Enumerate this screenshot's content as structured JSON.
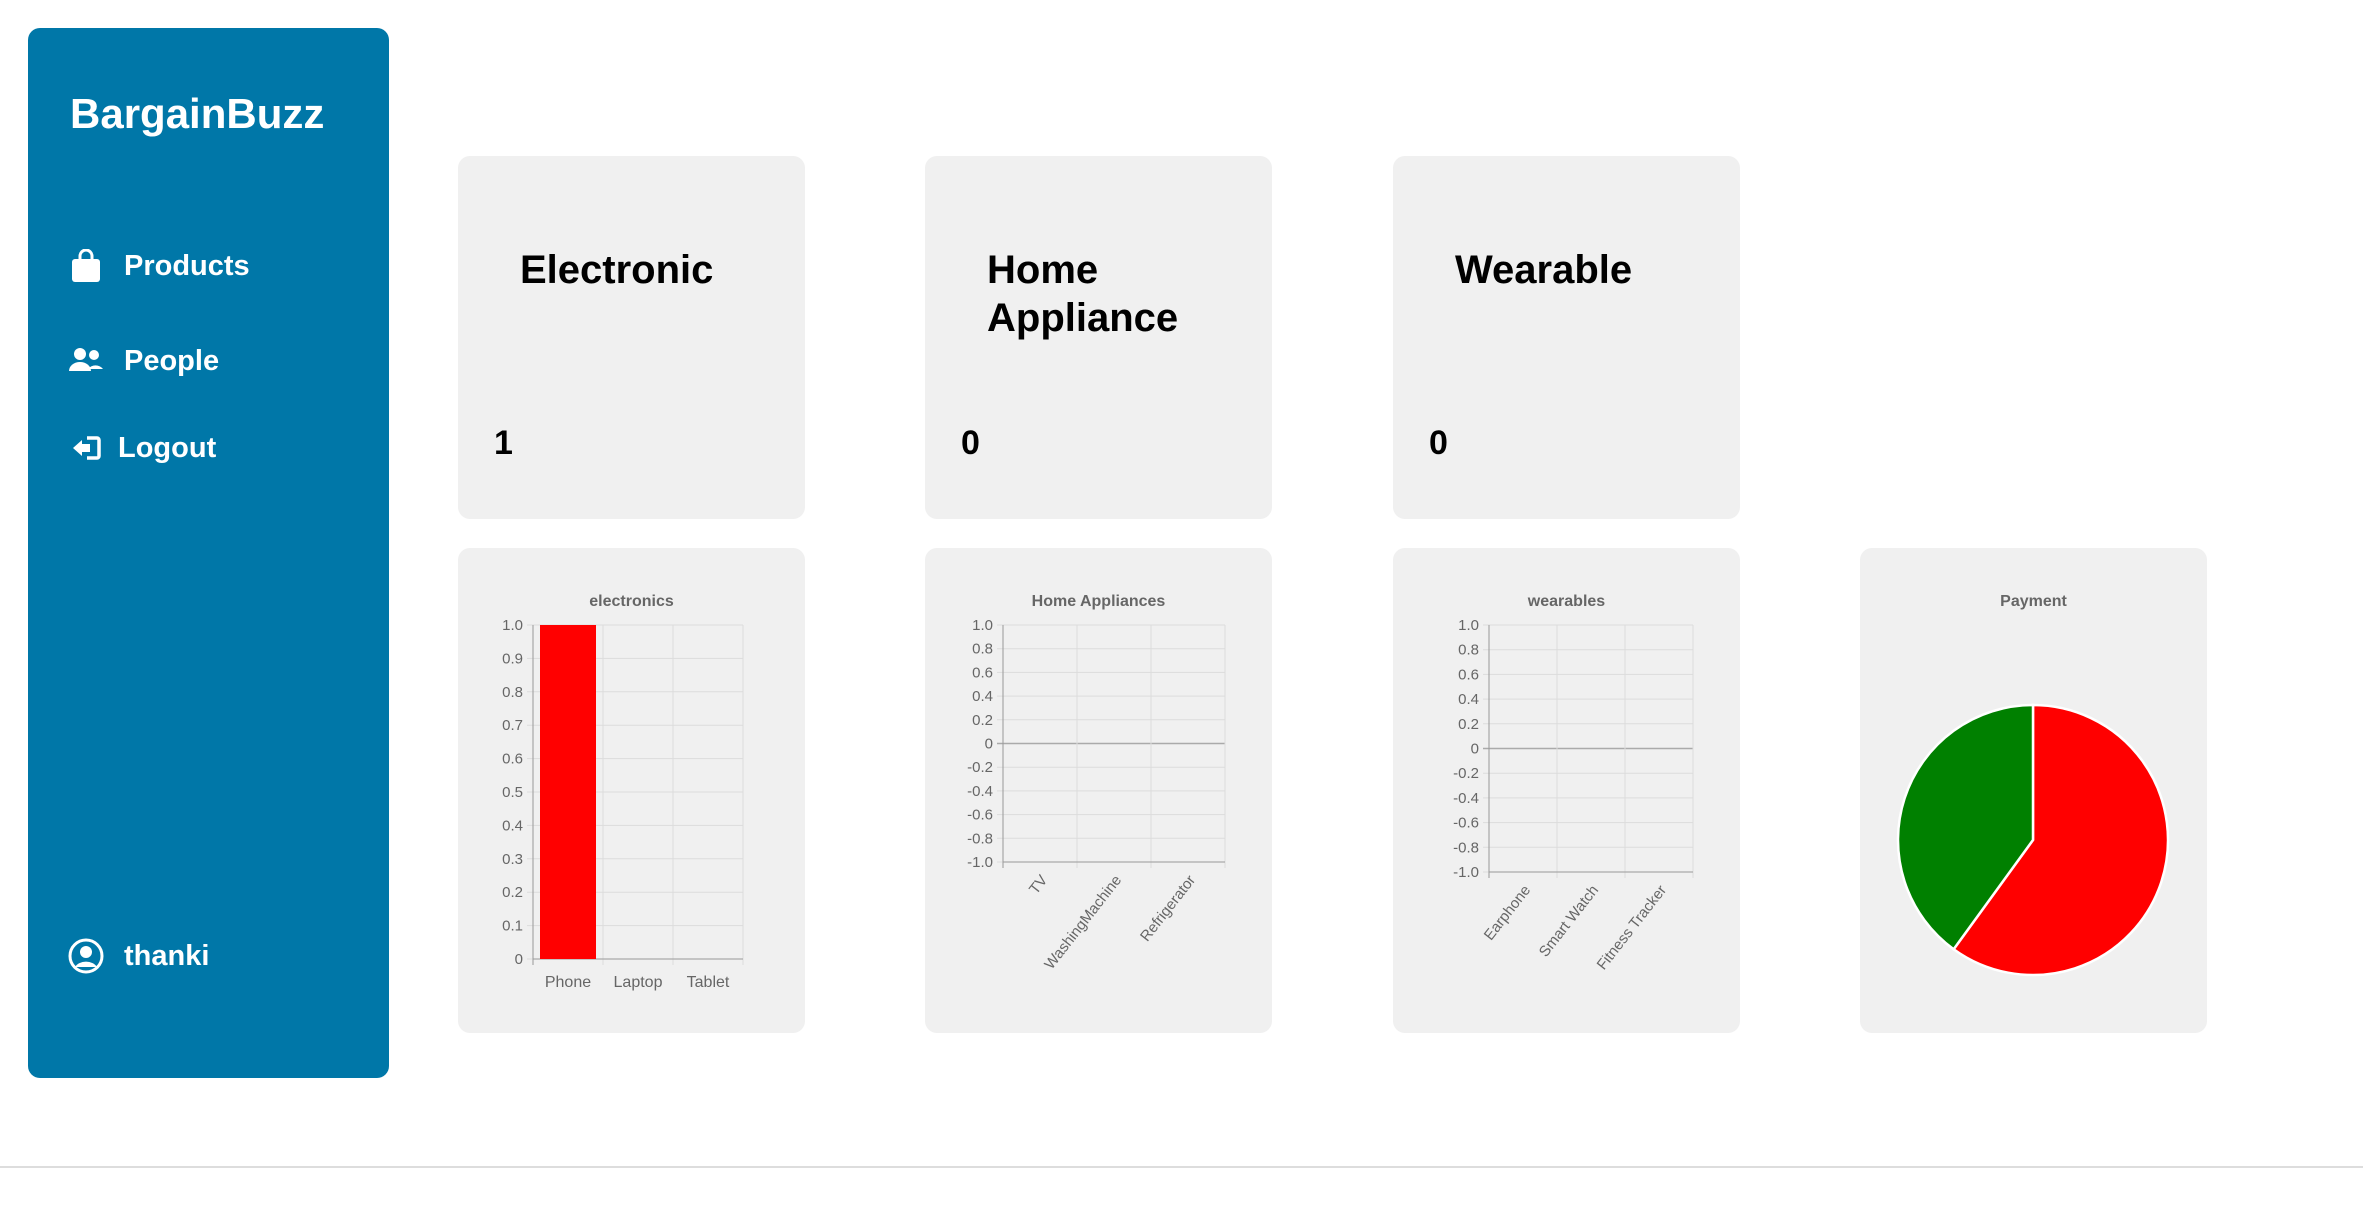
{
  "app": {
    "brand": "BargainBuzz"
  },
  "sidebar": {
    "items": [
      {
        "label": "Products",
        "icon": "shopping-bag-icon"
      },
      {
        "label": "People",
        "icon": "users-icon"
      },
      {
        "label": "Logout",
        "icon": "logout-icon"
      }
    ],
    "user": {
      "name": "thanki",
      "icon": "user-circle-icon"
    }
  },
  "stats": [
    {
      "title": "Electronic",
      "count": "1"
    },
    {
      "title": "Home Appliance",
      "count": "0"
    },
    {
      "title": "Wearable",
      "count": "0"
    }
  ],
  "colors": {
    "sidebar": "#0077a8",
    "card": "#f0f0f0",
    "bar": "#ff0000",
    "pie_red": "#ff0000",
    "pie_green": "#008000"
  },
  "chart_data": [
    {
      "type": "bar",
      "title": "electronics",
      "categories": [
        "Phone",
        "Laptop",
        "Tablet"
      ],
      "values": [
        1,
        0,
        0
      ],
      "ylim": [
        0,
        1.0
      ],
      "yticks": [
        "0",
        "0.1",
        "0.2",
        "0.3",
        "0.4",
        "0.5",
        "0.6",
        "0.7",
        "0.8",
        "0.9",
        "1.0"
      ],
      "grid": true
    },
    {
      "type": "bar",
      "title": "Home Appliances",
      "categories": [
        "TV",
        "WashingMachine",
        "Refrigerator"
      ],
      "values": [
        0,
        0,
        0
      ],
      "ylim": [
        -1.0,
        1.0
      ],
      "yticks": [
        "-1.0",
        "-0.8",
        "-0.6",
        "-0.4",
        "-0.2",
        "0",
        "0.2",
        "0.4",
        "0.6",
        "0.8",
        "1.0"
      ],
      "grid": true
    },
    {
      "type": "bar",
      "title": "wearables",
      "categories": [
        "Earphone",
        "Smart Watch",
        "Fitness Tracker"
      ],
      "values": [
        0,
        0,
        0
      ],
      "ylim": [
        -1.0,
        1.0
      ],
      "yticks": [
        "-1.0",
        "-0.8",
        "-0.6",
        "-0.4",
        "-0.2",
        "0",
        "0.2",
        "0.4",
        "0.6",
        "0.8",
        "1.0"
      ],
      "grid": true
    },
    {
      "type": "pie",
      "title": "Payment",
      "slices": [
        {
          "value": 60,
          "color": "#ff0000"
        },
        {
          "value": 40,
          "color": "#008000"
        }
      ]
    }
  ]
}
